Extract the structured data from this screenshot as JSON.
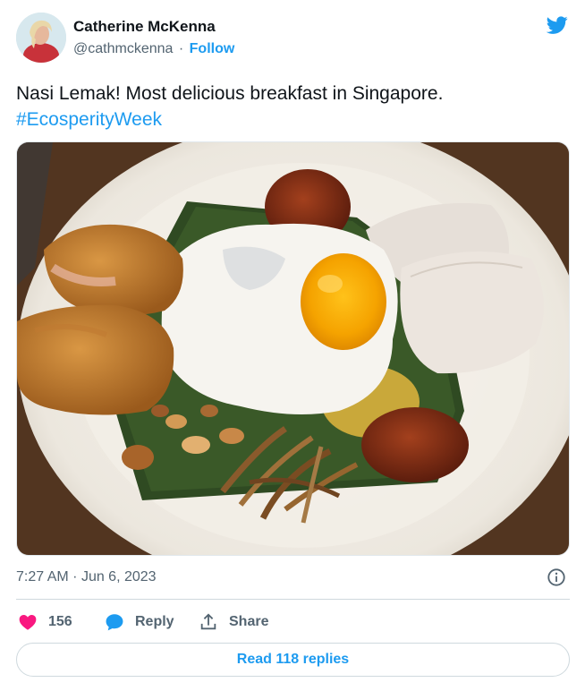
{
  "author": {
    "name": "Catherine McKenna",
    "handle": "@cathmckenna",
    "separator": "·",
    "follow_label": "Follow"
  },
  "tweet": {
    "text": "Nasi Lemak! Most delicious breakfast in Singapore.",
    "hashtag": "#EcosperityWeek"
  },
  "photo": {
    "icon": "food-photo"
  },
  "meta": {
    "time": "7:27 AM",
    "separator": "·",
    "date": "Jun 6, 2023"
  },
  "actions": {
    "likes": "156",
    "reply_label": "Reply",
    "share_label": "Share"
  },
  "read_replies_label": "Read 118 replies",
  "colors": {
    "accent": "#1d9bf0",
    "like": "#f91880",
    "text": "#0f1419",
    "secondary": "#536471"
  }
}
